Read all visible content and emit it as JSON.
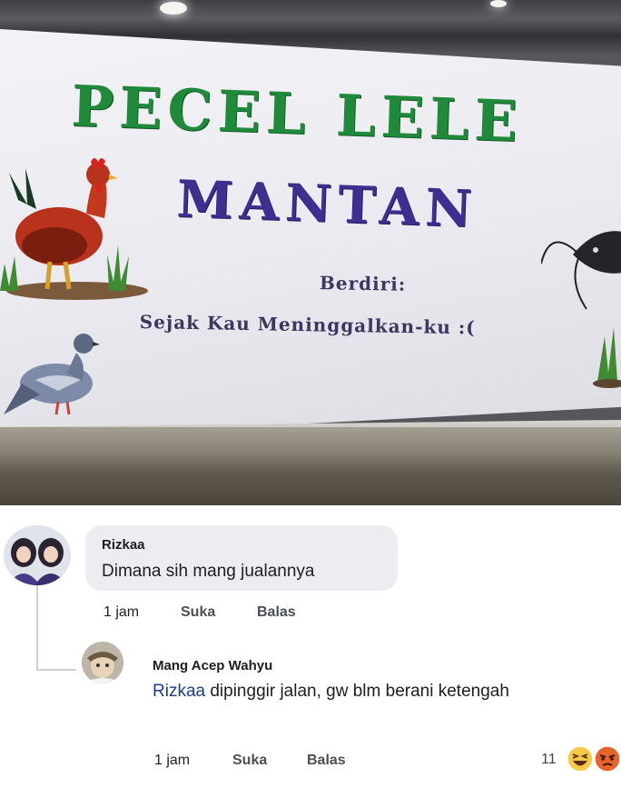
{
  "banner": {
    "title_line1": "PECEL LELE",
    "title_line2": "MANTAN",
    "subtitle_label": "Berdiri:",
    "subtitle_text": "Sejak Kau Meninggalkan-ku :("
  },
  "comments": [
    {
      "author": "Rizkaa",
      "text": "Dimana sih mang jualannya",
      "time": "1 jam",
      "like_label": "Suka",
      "reply_label": "Balas"
    }
  ],
  "reply": {
    "author": "Mang Acep Wahyu",
    "mention": "Rizkaa",
    "text": " dipinggir jalan, gw blm berani ketengah",
    "time": "1 jam",
    "like_label": "Suka",
    "reply_label": "Balas",
    "reaction_count": "11"
  },
  "colors": {
    "banner_green": "#1f8a3a",
    "banner_purple": "#3c2f8f",
    "bubble_bg": "#ebedf0",
    "mention": "#1a3e8c"
  },
  "icons": {
    "haha_reaction": "haha-icon",
    "angry_reaction": "angry-icon"
  }
}
